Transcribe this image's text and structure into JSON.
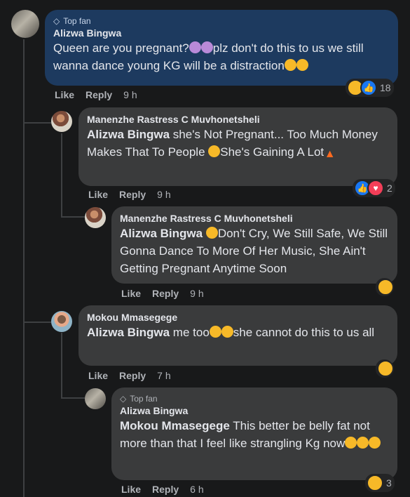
{
  "comments": [
    {
      "badge": "Top fan",
      "author": "Alizwa Bingwa",
      "text_a": "Queen are you pregnant?",
      "text_b": "plz don't do this to us we still wanna dance young KG will be a distraction",
      "actions": {
        "like": "Like",
        "reply": "Reply",
        "time": "9 h"
      },
      "reaction_count": "18"
    },
    {
      "author": "Manenzhe Rastress C Muvhonetsheli",
      "mention": "Alizwa Bingwa",
      "text_a": " she's Not Pregnant... Too Much Money Makes That To People ",
      "text_b": "She's Gaining A Lot",
      "actions": {
        "like": "Like",
        "reply": "Reply",
        "time": "9 h"
      },
      "reaction_count": "2"
    },
    {
      "author": "Manenzhe Rastress C Muvhonetsheli",
      "mention": "Alizwa Bingwa",
      "text_a": "Don't Cry, We Still Safe, We Still Gonna Dance To More Of Her Music, She Ain't Getting Pregnant Anytime Soon",
      "actions": {
        "like": "Like",
        "reply": "Reply",
        "time": "9 h"
      }
    },
    {
      "author": "Mokou Mmasegege",
      "mention": "Alizwa Bingwa",
      "text_a": " me too",
      "text_b": "she cannot do this to us all",
      "actions": {
        "like": "Like",
        "reply": "Reply",
        "time": "7 h"
      }
    },
    {
      "badge": "Top fan",
      "author": "Alizwa Bingwa",
      "mention": "Mokou Mmasegege",
      "text_a": " This better be belly fat not more than that I feel like strangling Kg now",
      "actions": {
        "like": "Like",
        "reply": "Reply",
        "time": "6 h"
      },
      "reaction_count": "3"
    }
  ],
  "colors": {
    "background": "#18191a",
    "bubble": "#3a3b3c",
    "highlight_bubble": "#1d3a5f",
    "meta_text": "#b0b3b8"
  }
}
